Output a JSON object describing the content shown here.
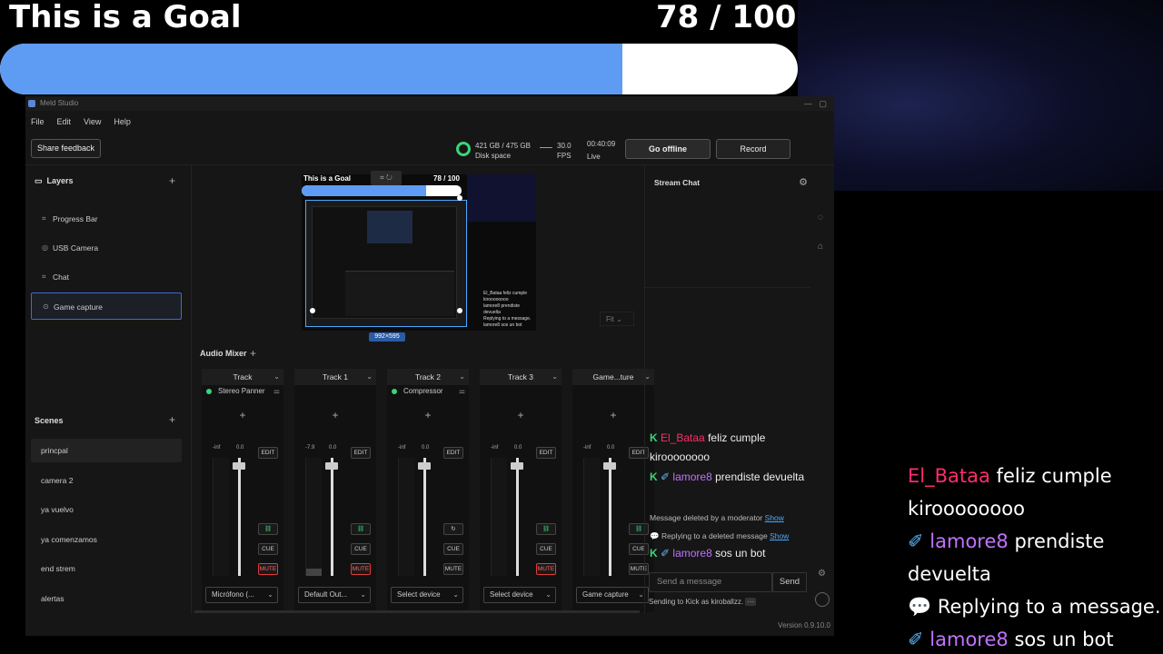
{
  "overlay": {
    "goal_title": "This is a Goal",
    "goal_count": "78 / 100",
    "goal_fraction": 0.78,
    "accent": "#5e9cf3"
  },
  "app": {
    "window_title": "Meld Studio",
    "menu": [
      "File",
      "Edit",
      "View",
      "Help"
    ],
    "toolbar": {
      "feedback_label": "Share feedback",
      "disk_value": "421 GB / 475 GB",
      "disk_label": "Disk space",
      "fps_value": "30.0",
      "fps_label": "FPS",
      "live_time": "00:40:09",
      "live_label": "Live",
      "go_offline_label": "Go offline",
      "record_label": "Record"
    },
    "layers": {
      "title": "Layers",
      "items": [
        {
          "label": "Progress Bar",
          "icon": "layers-icon"
        },
        {
          "label": "USB Camera",
          "icon": "camera-icon"
        },
        {
          "label": "Chat",
          "icon": "layers-icon"
        },
        {
          "label": "Game capture",
          "icon": "gamepad-icon",
          "selected": true
        }
      ]
    },
    "scenes": {
      "title": "Scenes",
      "items": [
        "princpal",
        "camera 2",
        "ya vuelvo",
        "ya comenzamos",
        "end strem",
        "alertas"
      ],
      "selected": "princpal"
    },
    "preview": {
      "title": "This is a Goal",
      "count": "78 / 100",
      "size_badge": "992×595",
      "fit_label": "Fit",
      "chat_lines": [
        "El_Bataa feliz cumple kiroooooooo",
        "lamore8 prendiste devuelta",
        "Replying to a message.",
        "lamore8 sos un bot"
      ]
    },
    "mixer": {
      "title": "Audio Mixer",
      "tracks": [
        {
          "name": "Track",
          "effect": "Stereo Panner",
          "db_left": "-inf",
          "db_right": "0.0",
          "level": 0.0,
          "fader": 0.95,
          "mute_on": true,
          "select": "Micrófono (...",
          "show_link": true
        },
        {
          "name": "Track 1",
          "effect": "",
          "db_left": "-7.9",
          "db_right": "0.0",
          "level": 0.06,
          "fader": 0.95,
          "mute_on": true,
          "select": "Default Out...",
          "show_link": true
        },
        {
          "name": "Track 2",
          "effect": "Compressor",
          "db_left": "-inf",
          "db_right": "0.0",
          "level": 0.0,
          "fader": 0.95,
          "mute_on": false,
          "select": "Select device",
          "show_link": true
        },
        {
          "name": "Track 3",
          "effect": "",
          "db_left": "-inf",
          "db_right": "0.0",
          "level": 0.0,
          "fader": 0.95,
          "mute_on": true,
          "select": "Select device",
          "show_link": true
        },
        {
          "name": "Game...ture",
          "effect": "",
          "db_left": "-inf",
          "db_right": "0.0",
          "level": 0.0,
          "fader": 0.95,
          "mute_on": false,
          "select": "Game capture",
          "show_link": false
        }
      ],
      "edit_label": "EDIT",
      "cue_label": "CUE",
      "mute_label": "MUTE"
    },
    "stream_chat": {
      "title": "Stream Chat",
      "messages": [
        {
          "user": "El_Bataa",
          "text": "feliz cumple kiroooooooo",
          "user_color": "#ff2c6a"
        },
        {
          "user": "lamore8",
          "text": "prendiste devuelta",
          "user_color": "#c173ff"
        }
      ],
      "deleted_note": "Message deleted by a moderator",
      "deleted_show": "Show",
      "reply_note": "Replying to a deleted message",
      "reply_show": "Show",
      "last_user": "lamore8",
      "last_text": "sos un bot",
      "input_placeholder": "Send a message",
      "send_label": "Send",
      "sending_note": "Sending to Kick as kiroballzz."
    },
    "version": "Version 0.9.10.0"
  },
  "overlay_chat": {
    "messages": [
      {
        "user": "El_Bataa",
        "text": "feliz cumple kiroooooooo"
      },
      {
        "user": "lamore8",
        "text": "prendiste devuelta"
      },
      {
        "reply": "Replying to a message."
      },
      {
        "user": "lamore8",
        "text": "sos un bot"
      }
    ]
  }
}
